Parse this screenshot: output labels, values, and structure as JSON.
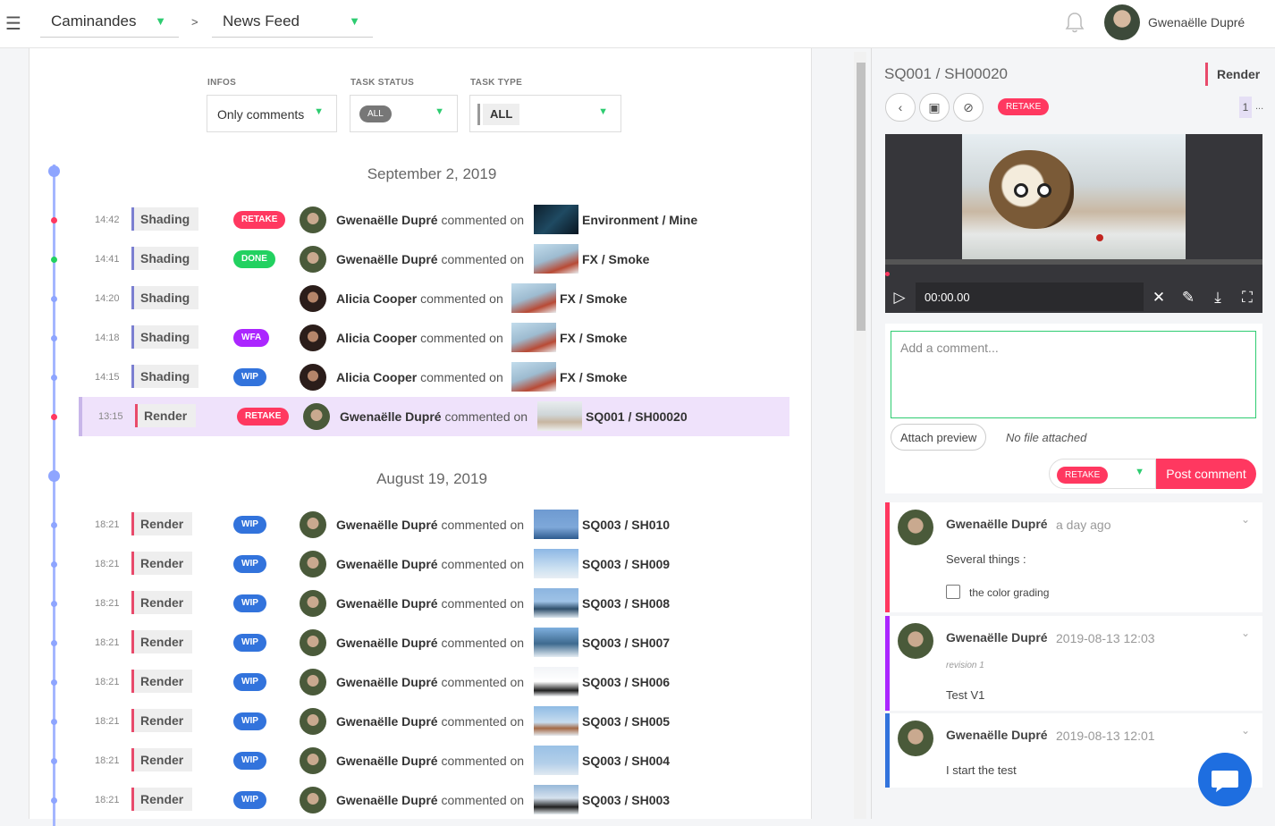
{
  "topbar": {
    "production": "Caminandes",
    "section": "News Feed",
    "separator": ">",
    "user_name": "Gwenaëlle Dupré"
  },
  "filters": {
    "infos_label": "INFOS",
    "infos_value": "Only comments",
    "status_label": "TASK STATUS",
    "status_value": "ALL",
    "type_label": "TASK TYPE",
    "type_value": "ALL"
  },
  "feed": {
    "date1": "September 2, 2019",
    "date2": "August 19, 2019",
    "commented_on": "commented on",
    "rows": [
      {
        "time": "14:42",
        "task": "Shading",
        "status": "RETAKE",
        "user": "Gwenaëlle Dupré",
        "entity": "Environment / Mine"
      },
      {
        "time": "14:41",
        "task": "Shading",
        "status": "DONE",
        "user": "Gwenaëlle Dupré",
        "entity": "FX / Smoke"
      },
      {
        "time": "14:20",
        "task": "Shading",
        "status": "",
        "user": "Alicia Cooper",
        "entity": "FX / Smoke"
      },
      {
        "time": "14:18",
        "task": "Shading",
        "status": "WFA",
        "user": "Alicia Cooper",
        "entity": "FX / Smoke"
      },
      {
        "time": "14:15",
        "task": "Shading",
        "status": "WIP",
        "user": "Alicia Cooper",
        "entity": "FX / Smoke"
      },
      {
        "time": "13:15",
        "task": "Render",
        "status": "RETAKE",
        "user": "Gwenaëlle Dupré",
        "entity": "SQ001 / SH00020"
      },
      {
        "time": "18:21",
        "task": "Render",
        "status": "WIP",
        "user": "Gwenaëlle Dupré",
        "entity": "SQ003 / SH010"
      },
      {
        "time": "18:21",
        "task": "Render",
        "status": "WIP",
        "user": "Gwenaëlle Dupré",
        "entity": "SQ003 / SH009"
      },
      {
        "time": "18:21",
        "task": "Render",
        "status": "WIP",
        "user": "Gwenaëlle Dupré",
        "entity": "SQ003 / SH008"
      },
      {
        "time": "18:21",
        "task": "Render",
        "status": "WIP",
        "user": "Gwenaëlle Dupré",
        "entity": "SQ003 / SH007"
      },
      {
        "time": "18:21",
        "task": "Render",
        "status": "WIP",
        "user": "Gwenaëlle Dupré",
        "entity": "SQ003 / SH006"
      },
      {
        "time": "18:21",
        "task": "Render",
        "status": "WIP",
        "user": "Gwenaëlle Dupré",
        "entity": "SQ003 / SH005"
      },
      {
        "time": "18:21",
        "task": "Render",
        "status": "WIP",
        "user": "Gwenaëlle Dupré",
        "entity": "SQ003 / SH004"
      },
      {
        "time": "18:21",
        "task": "Render",
        "status": "WIP",
        "user": "Gwenaëlle Dupré",
        "entity": "SQ003 / SH003"
      }
    ]
  },
  "colors": {
    "shading": "#7b7fd1",
    "render": "#e84a6b",
    "retake": "#ff3860",
    "done": "#22d160",
    "wfa": "#ab26ff",
    "wip": "#3273dc"
  },
  "panel": {
    "title": "SQ001 / SH00020",
    "task_type": "Render",
    "status": "RETAKE",
    "revision": "1",
    "revision_more": "...",
    "timecode": "00:00.00",
    "comment_placeholder": "Add a comment...",
    "attach_label": "Attach preview",
    "no_file": "No file attached",
    "post_status": "RETAKE",
    "post_label": "Post comment"
  },
  "comments": [
    {
      "author": "Gwenaëlle Dupré",
      "when": "a day ago",
      "text": "Several things :",
      "checklist": "the color grading"
    },
    {
      "author": "Gwenaëlle Dupré",
      "when": "2019-08-13 12:03",
      "revision": "revision 1",
      "text": "Test V1"
    },
    {
      "author": "Gwenaëlle Dupré",
      "when": "2019-08-13 12:01",
      "text": "I start the test"
    }
  ]
}
